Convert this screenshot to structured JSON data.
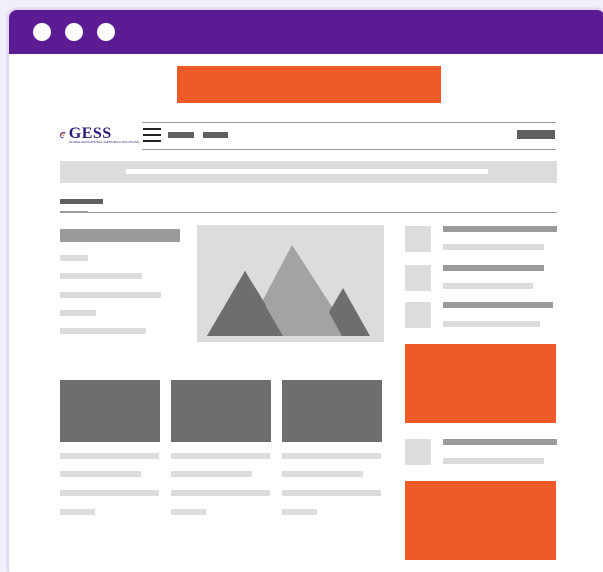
{
  "window": {
    "title_bar_color": "#5b1b93",
    "controls": [
      "window-dot-icon",
      "window-dot-icon",
      "window-dot-icon"
    ]
  },
  "site": {
    "logo": {
      "name": "GESS",
      "tagline": "GLOBAL EDUCATIONAL SUPPLIES & SOLUTIONS"
    }
  },
  "colors": {
    "accent": "#ef5a29",
    "brand": "#5b1b93",
    "placeholder_dark": "#6e6e6e",
    "placeholder_light": "#dcdcdc"
  },
  "icons": {
    "menu": "hamburger-menu-icon",
    "image": "mountain-image-icon"
  }
}
